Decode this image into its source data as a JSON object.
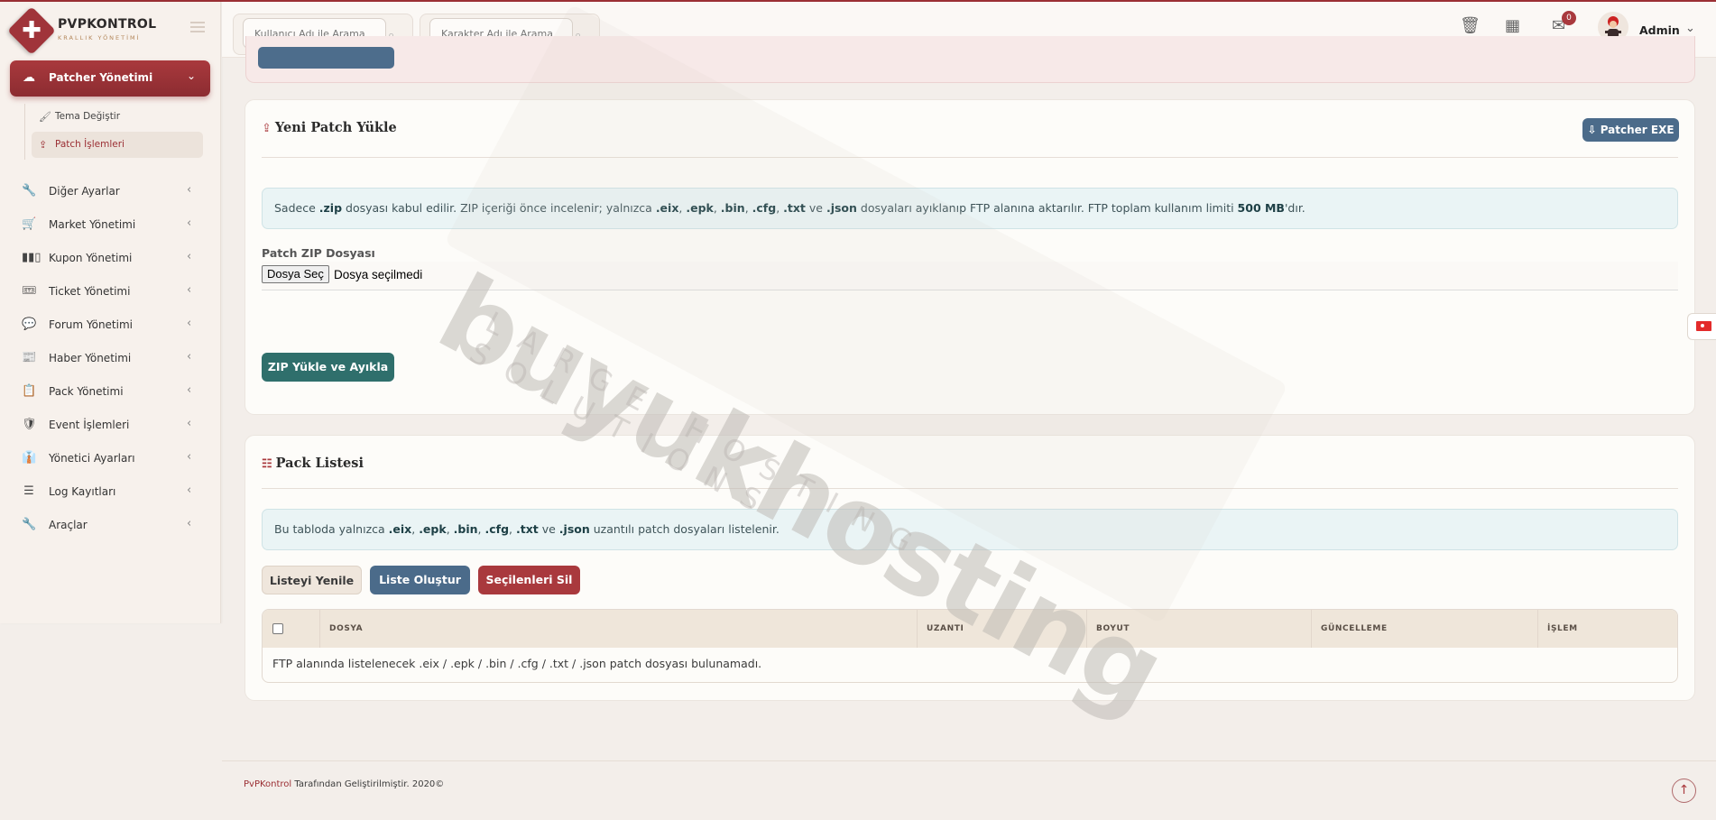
{
  "brand": {
    "title": "PVPKONTROL",
    "subtitle": "KRALLIK YÖNETİMİ"
  },
  "sidebar": {
    "active": {
      "label": "Patcher Yönetimi",
      "icon": "cloud-upload-icon"
    },
    "submenu": [
      {
        "label": "Tema Değiştir",
        "icon": "brush-icon"
      },
      {
        "label": "Patch İşlemleri",
        "icon": "upload-icon",
        "active": true
      }
    ],
    "items": [
      {
        "label": "Diğer Ayarlar",
        "icon": "wrench-icon",
        "glyph": "🔧"
      },
      {
        "label": "Market Yönetimi",
        "icon": "cart-icon",
        "glyph": "🛒"
      },
      {
        "label": "Kupon Yönetimi",
        "icon": "barcode-icon",
        "glyph": "▮▮▯"
      },
      {
        "label": "Ticket Yönetimi",
        "icon": "ticket-icon",
        "glyph": "🎟"
      },
      {
        "label": "Forum Yönetimi",
        "icon": "comments-icon",
        "glyph": "💬"
      },
      {
        "label": "Haber Yönetimi",
        "icon": "newspaper-icon",
        "glyph": "📰"
      },
      {
        "label": "Pack Yönetimi",
        "icon": "clipboard-icon",
        "glyph": "📋"
      },
      {
        "label": "Event İşlemleri",
        "icon": "shield-icon",
        "glyph": "🛡"
      },
      {
        "label": "Yönetici Ayarları",
        "icon": "user-tie-icon",
        "glyph": "👔"
      },
      {
        "label": "Log Kayıtları",
        "icon": "list-icon",
        "glyph": "☰"
      },
      {
        "label": "Araçlar",
        "icon": "tools-icon",
        "glyph": "🔧"
      }
    ]
  },
  "topbar": {
    "search_user_placeholder": "Kullanıcı Adı ile Arama",
    "search_char_placeholder": "Karakter Adı ile Arama",
    "notification_count": "0",
    "username": "Admin"
  },
  "upload_card": {
    "title": "Yeni Patch Yükle",
    "patcher_button": "Patcher EXE",
    "info_prefix": "Sadece ",
    "info_zip": ".zip",
    "info_mid": " dosyası kabul edilir. ZIP içeriği önce incelenir; yalnızca ",
    "info_exts": [
      ".eix",
      ".epk",
      ".bin",
      ".cfg",
      ".txt"
    ],
    "info_and": " ve ",
    "info_json": ".json",
    "info_tail": " dosyaları ayıklanıp FTP alanına aktarılır. FTP toplam kullanım limiti ",
    "info_limit": "500 MB",
    "info_end": "'dır.",
    "file_label": "Patch ZIP Dosyası",
    "file_button": "Dosya Seç",
    "file_status": "Dosya seçilmedi",
    "submit_button": "ZIP Yükle ve Ayıkla"
  },
  "pack_card": {
    "title": "Pack Listesi",
    "info_prefix": "Bu tabloda yalnızca ",
    "info_exts": [
      ".eix",
      ".epk",
      ".bin",
      ".cfg",
      ".txt"
    ],
    "info_and": " ve ",
    "info_json": ".json",
    "info_tail": " uzantılı patch dosyaları listelenir.",
    "btn_refresh": "Listeyi Yenile",
    "btn_create": "Liste Oluştur",
    "btn_delete": "Seçilenleri Sil",
    "columns": [
      "DOSYA",
      "UZANTI",
      "BOYUT",
      "GÜNCELLEME",
      "İŞLEM"
    ],
    "empty_text": "FTP alanında listelenecek .eix / .epk / .bin / .cfg / .txt / .json patch dosyası bulunamadı."
  },
  "watermark": {
    "main": "buyukhosting",
    "sub": "LARGE HOSTING SOLUTIONS"
  },
  "footer": {
    "brand": "PvPKontrol",
    "text": " Tarafından Geliştirilmiştir. 2020©"
  },
  "colors": {
    "accent": "#a9393d",
    "blue": "#4b6b8a",
    "teal": "#2f6f6c"
  }
}
